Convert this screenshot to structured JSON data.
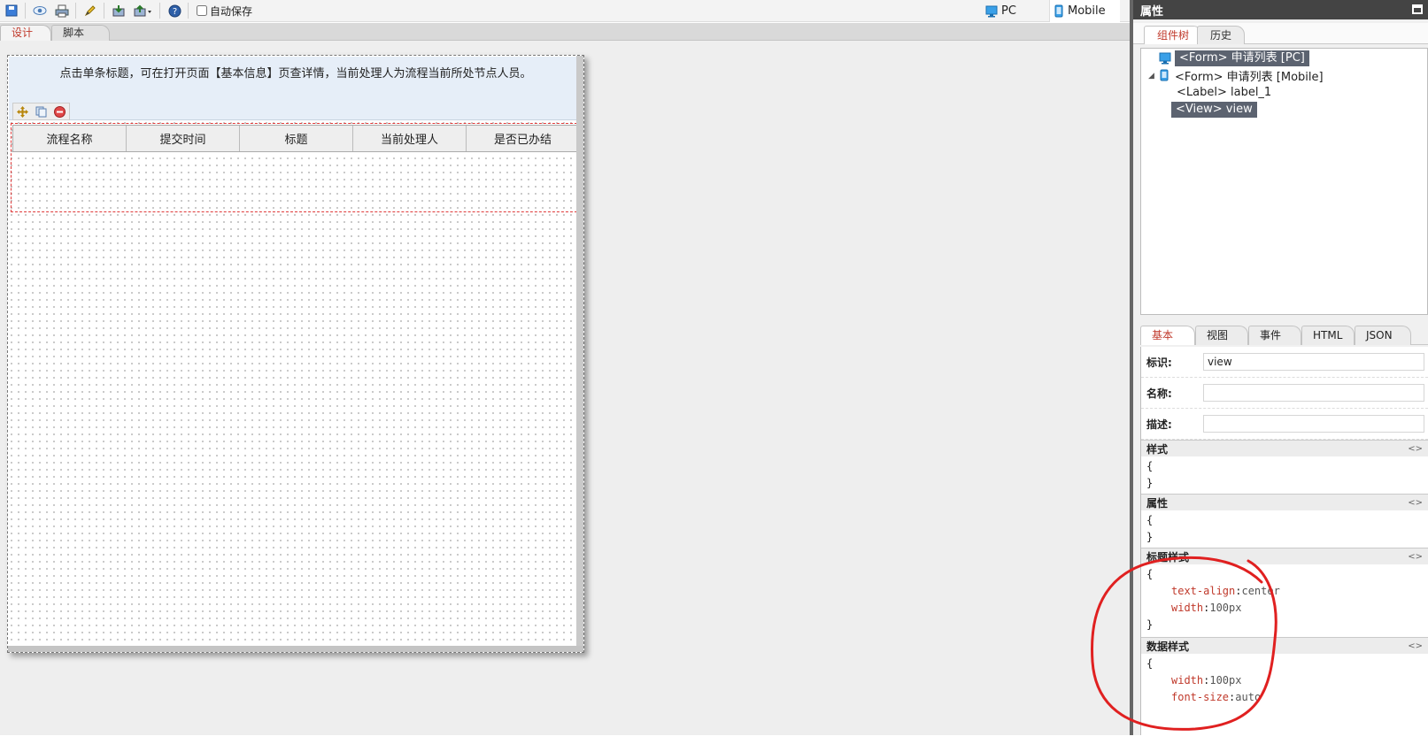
{
  "toolbar": {
    "icons": [
      "save-icon",
      "preview-icon",
      "print-icon",
      "pen-icon",
      "import-icon",
      "export-icon",
      "help-icon"
    ],
    "autosave_label": "自动保存",
    "device_pc": "PC",
    "device_mobile": "Mobile"
  },
  "tabs": [
    {
      "label": "设计",
      "active": true
    },
    {
      "label": "脚本",
      "active": false
    }
  ],
  "form": {
    "label_text": "点击单条标题，可在打开页面【基本信息】页查详情，当前处理人为流程当前所处节点人员。",
    "columns": [
      "流程名称",
      "提交时间",
      "标题",
      "当前处理人",
      "是否已办结"
    ]
  },
  "right_panel": {
    "title": "属性",
    "tabs": [
      "组件树",
      "历史"
    ],
    "tree": [
      {
        "text": "<Form> 申请列表 [PC]"
      },
      {
        "text": "<Form> 申请列表 [Mobile]"
      },
      {
        "text": "<Label> label_1"
      },
      {
        "text": "<View> view"
      }
    ],
    "prop_tabs": [
      "基本",
      "视图",
      "事件",
      "HTML",
      "JSON"
    ],
    "fields": {
      "id_label": "标识:",
      "id_value": "view",
      "name_label": "名称:",
      "name_value": "",
      "desc_label": "描述:",
      "desc_value": ""
    },
    "sections": {
      "style": {
        "title": "样式",
        "open": "{",
        "close": "}"
      },
      "attrs": {
        "title": "属性",
        "open": "{",
        "close": "}"
      },
      "title_style": {
        "title": "标题样式",
        "open": "{",
        "close": "}",
        "k1": "text-align",
        "v1": "center",
        "k2": "width",
        "v2": "100px"
      },
      "data_style": {
        "title": "数据样式",
        "open": "{",
        "k1": "width",
        "v1": "100px",
        "k2": "font-size",
        "v2": "auto"
      }
    },
    "code_toggle": "<>"
  },
  "colors": {
    "accent_red": "#c0392b",
    "selection": "#5c6370",
    "annotation": "#e02020"
  }
}
